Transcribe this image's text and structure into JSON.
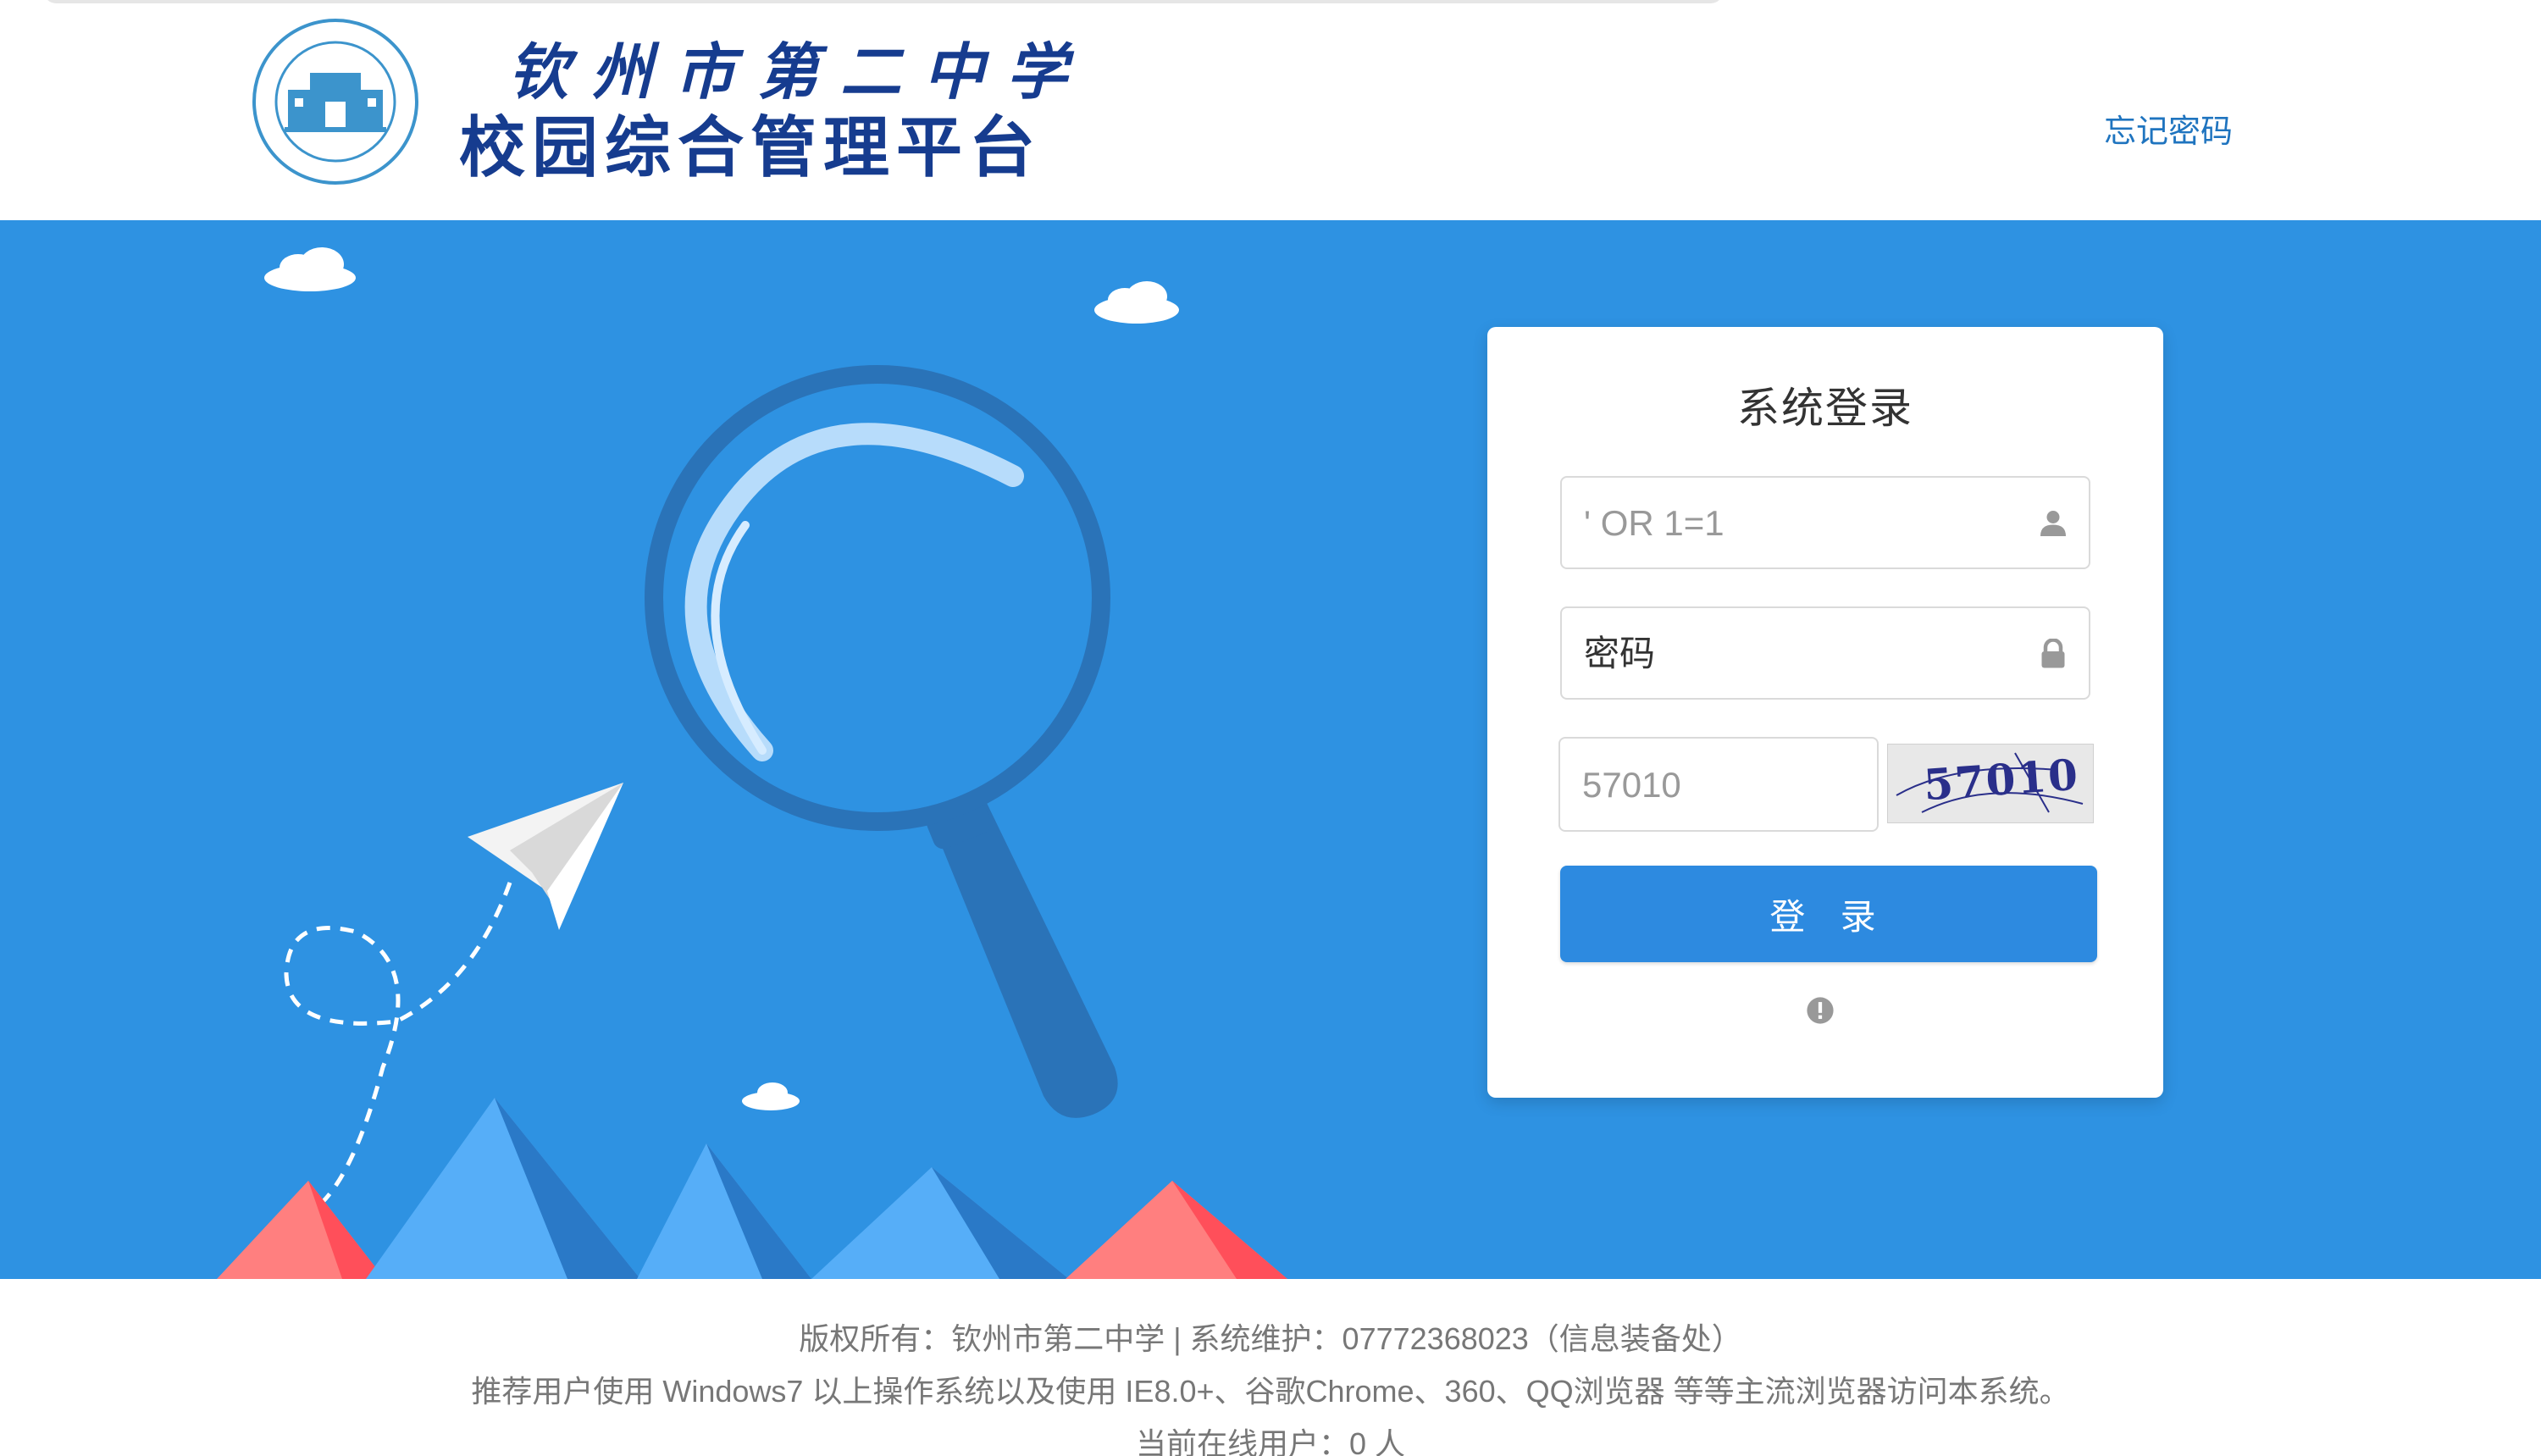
{
  "header": {
    "logo_line1": "钦州市第二中学",
    "logo_line2": "校园综合管理平台",
    "forgot_password_link": "忘记密码"
  },
  "login": {
    "title": "系统登录",
    "username_value": "' OR 1=1",
    "password_placeholder": "密码",
    "captcha_input_value": "57010",
    "captcha_image_text": "57010",
    "submit_label": "登 录"
  },
  "footer": {
    "copyright": "版权所有：钦州市第二中学 | 系统维护：07772368023（信息装备处）",
    "browser_hint": "推荐用户使用 Windows7 以上操作系统以及使用 IE8.0+、谷歌Chrome、360、QQ浏览器 等等主流浏览器访问本系统。",
    "online_users": "当前在线用户：0 人"
  },
  "colors": {
    "banner_blue": "#2e92e2",
    "button_blue": "#2d8ae0",
    "logo_navy": "#163c8f",
    "link_blue": "#1f74bf"
  },
  "icons": [
    "user-icon",
    "lock-icon",
    "info-icon",
    "school-seal-logo"
  ]
}
